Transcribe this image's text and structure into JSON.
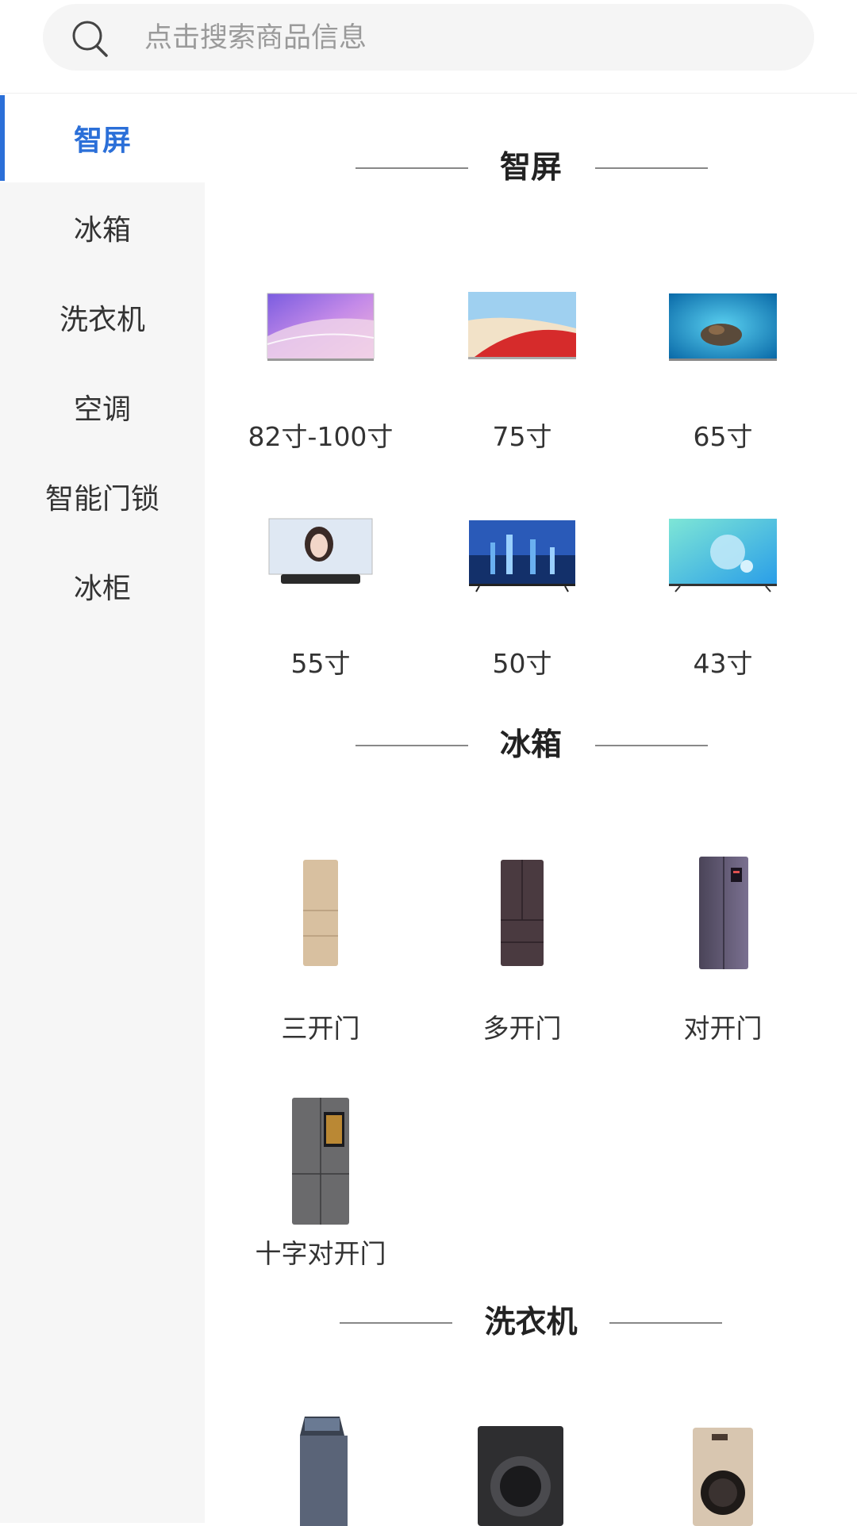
{
  "search": {
    "placeholder": "点击搜索商品信息",
    "icon": "search-icon"
  },
  "sidebar": {
    "items": [
      {
        "label": "智屏",
        "active": true
      },
      {
        "label": "冰箱",
        "active": false
      },
      {
        "label": "洗衣机",
        "active": false
      },
      {
        "label": "空调",
        "active": false
      },
      {
        "label": "智能门锁",
        "active": false
      },
      {
        "label": "冰柜",
        "active": false
      }
    ]
  },
  "sections": [
    {
      "title": "智屏",
      "products": [
        {
          "label": "82寸-100寸",
          "icon": "tv-purple-wave-image"
        },
        {
          "label": "75寸",
          "icon": "tv-red-landscape-image"
        },
        {
          "label": "65寸",
          "icon": "tv-blue-underwater-image"
        },
        {
          "label": "55寸",
          "icon": "tv-portrait-soundbar-image"
        },
        {
          "label": "50寸",
          "icon": "tv-city-skyline-image"
        },
        {
          "label": "43寸",
          "icon": "tv-teal-sphere-image"
        }
      ]
    },
    {
      "title": "冰箱",
      "products": [
        {
          "label": "三开门",
          "icon": "fridge-three-door-image"
        },
        {
          "label": "多开门",
          "icon": "fridge-multi-door-image"
        },
        {
          "label": "对开门",
          "icon": "fridge-side-by-side-image"
        },
        {
          "label": "十字对开门",
          "icon": "fridge-cross-door-image"
        }
      ]
    },
    {
      "title": "洗衣机",
      "products": [
        {
          "label": "",
          "icon": "washer-top-load-image"
        },
        {
          "label": "",
          "icon": "washer-front-load-dark-image"
        },
        {
          "label": "",
          "icon": "washer-front-load-champagne-image"
        }
      ]
    }
  ],
  "colors": {
    "accent": "#2b6fd8",
    "sidebar_bg": "#f6f6f6",
    "search_bg": "#f5f5f5"
  }
}
